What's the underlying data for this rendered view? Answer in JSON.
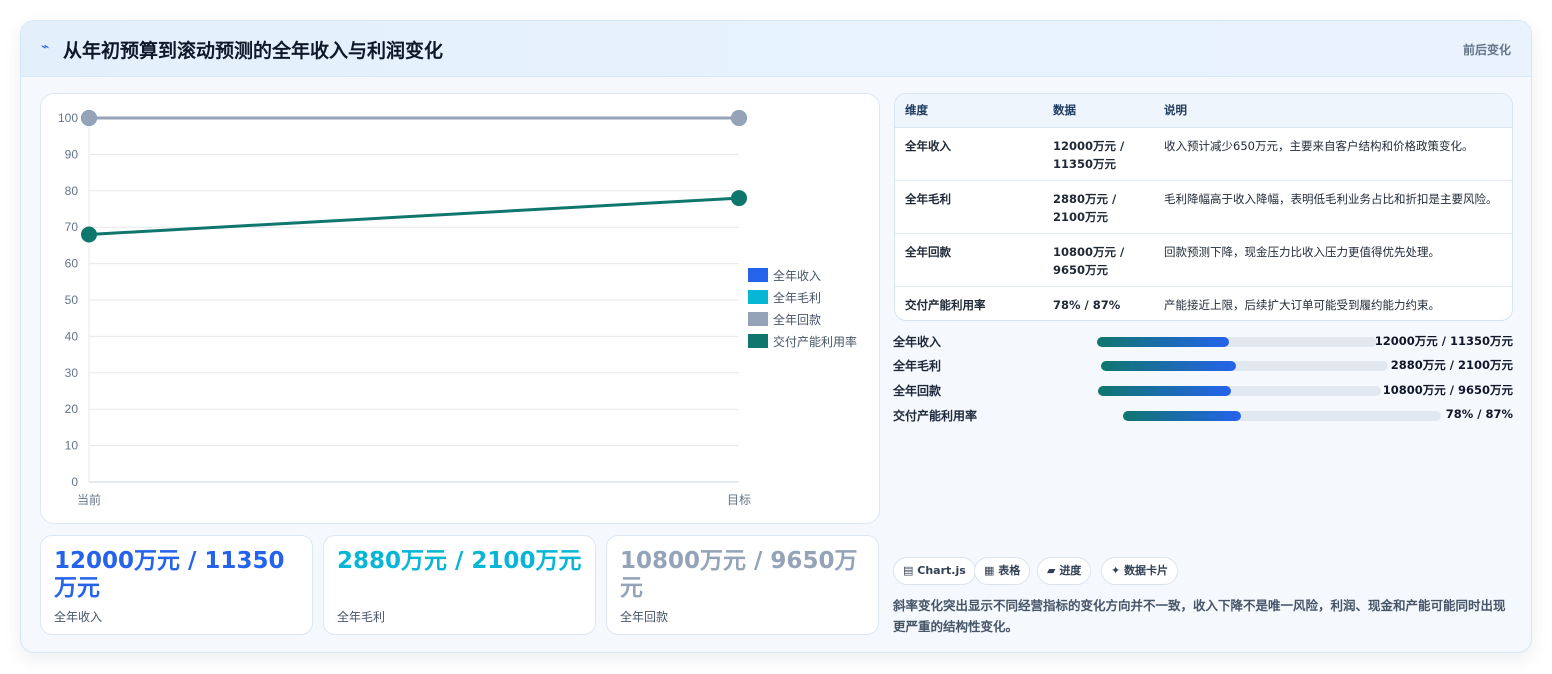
{
  "header": {
    "icon": "lightning-icon",
    "title": "从年初预算到滚动预测的全年收入与利润变化",
    "tag": "前后变化"
  },
  "chart_data": {
    "type": "line",
    "categories": [
      "当前",
      "目标"
    ],
    "ylim": [
      0,
      100
    ],
    "yticks": [
      0,
      10,
      20,
      30,
      40,
      50,
      60,
      70,
      80,
      90,
      100
    ],
    "legend_position": "right",
    "grid": true,
    "series": [
      {
        "name": "全年收入",
        "color": "#2563eb",
        "values": [
          100,
          100
        ]
      },
      {
        "name": "全年毛利",
        "color": "#06b6d4",
        "values": [
          100,
          100
        ]
      },
      {
        "name": "全年回款",
        "color": "#94a3b8",
        "values": [
          100,
          100
        ]
      },
      {
        "name": "交付产能利用率",
        "color": "#0f766e",
        "values": [
          68,
          78
        ]
      }
    ]
  },
  "kpis": [
    {
      "value": "12000万元 / 11350万元",
      "label": "全年收入",
      "color": "#2563eb"
    },
    {
      "value": "2880万元 / 2100万元",
      "label": "全年毛利",
      "color": "#06b6d4"
    },
    {
      "value": "10800万元 / 9650万元",
      "label": "全年回款",
      "color": "#94a3b8"
    }
  ],
  "table": {
    "headers": [
      "维度",
      "数据",
      "说明"
    ],
    "rows": [
      {
        "dim": "全年收入",
        "data": "12000万元 / 11350万元",
        "desc": "收入预计减少650万元，主要来自客户结构和价格政策变化。"
      },
      {
        "dim": "全年毛利",
        "data": "2880万元 / 2100万元",
        "desc": "毛利降幅高于收入降幅，表明低毛利业务占比和折扣是主要风险。"
      },
      {
        "dim": "全年回款",
        "data": "10800万元 / 9650万元",
        "desc": "回款预测下降，现金压力比收入压力更值得优先处理。"
      },
      {
        "dim": "交付产能利用率",
        "data": "78% / 87%",
        "desc": "产能接近上限，后续扩大订单可能受到履约能力约束。"
      }
    ]
  },
  "progress": [
    {
      "label": "全年收入",
      "value": "12000万元 / 11350万元",
      "fill": 0.47
    },
    {
      "label": "全年毛利",
      "value": "2880万元 / 2100万元",
      "fill": 0.47
    },
    {
      "label": "全年回款",
      "value": "10800万元 / 9650万元",
      "fill": 0.47
    },
    {
      "label": "交付产能利用率",
      "value": "78% / 87%",
      "fill": 0.37
    }
  ],
  "chips": [
    {
      "icon": "chart-icon",
      "glyph": "▤",
      "label": "Chart.js"
    },
    {
      "icon": "table-icon",
      "glyph": "▦",
      "label": "表格"
    },
    {
      "icon": "progress-icon",
      "glyph": "▰",
      "label": "进度"
    },
    {
      "icon": "sparkle-icon",
      "glyph": "✦",
      "label": "数据卡片"
    }
  ],
  "note": "斜率变化突出显示不同经营指标的变化方向并不一致，收入下降不是唯一风险，利润、现金和产能可能同时出现更严重的结构性变化。"
}
